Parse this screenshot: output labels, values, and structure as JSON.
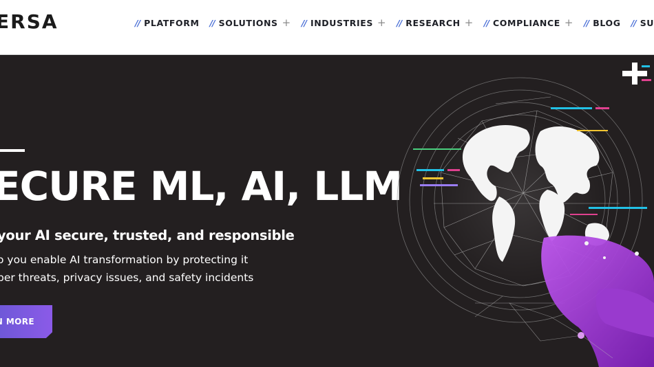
{
  "brand": {
    "logo_text": "ERSA"
  },
  "nav": {
    "items": [
      {
        "label": "PLATFORM",
        "expandable": false
      },
      {
        "label": "SOLUTIONS",
        "expandable": true
      },
      {
        "label": "INDUSTRIES",
        "expandable": true
      },
      {
        "label": "RESEARCH",
        "expandable": true
      },
      {
        "label": "COMPLIANCE",
        "expandable": true
      },
      {
        "label": "BLOG",
        "expandable": false
      },
      {
        "label": "SUBSCRIBE",
        "expandable": false
      }
    ],
    "separator": "//",
    "expand_glyph": "+"
  },
  "hero": {
    "title": "ECURE ML, AI, LLM",
    "subtitle": "your AI secure, trusted, and responsible",
    "description_lines": [
      "o you enable AI transformation by protecting it",
      "ber threats, privacy issues, and safety incidents"
    ],
    "cta_label": "N MORE"
  },
  "colors": {
    "header_bg": "#ffffff",
    "hero_bg": "#231f20",
    "nav_text": "#1d1f26",
    "nav_separator": "#4a6fd6",
    "cta_gradient_start": "#6f58d8",
    "cta_gradient_end": "#8b5ae8",
    "accent_purple": "#a03cd8",
    "hero_text": "#ffffff"
  },
  "icons": {
    "nav_expand": "plus-icon",
    "hero_graphic": "network-globe-illustration"
  }
}
